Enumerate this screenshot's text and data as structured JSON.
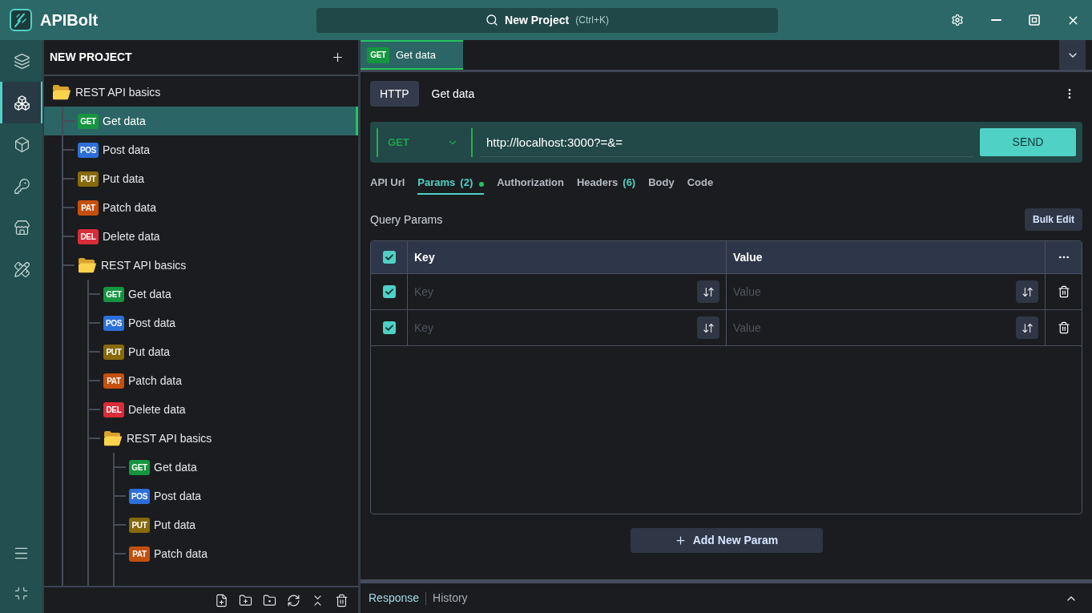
{
  "app": {
    "name": "APIBolt"
  },
  "search": {
    "label": "New Project",
    "shortcut": "(Ctrl+K)"
  },
  "activity_bar": [
    {
      "selected": false
    },
    {
      "selected": true
    },
    {
      "selected": false
    },
    {
      "selected": false
    },
    {
      "selected": false
    },
    {
      "selected": false
    }
  ],
  "sidebar": {
    "title": "NEW PROJECT",
    "tree": [
      {
        "kind": "folder",
        "label": "REST API basics",
        "expanded": true,
        "selected": false,
        "children": [
          {
            "kind": "request",
            "method": "GET",
            "color": "#15953f",
            "label": "Get data",
            "selected": true
          },
          {
            "kind": "request",
            "method": "POS",
            "color": "#2d6fd8",
            "label": "Post data",
            "selected": false
          },
          {
            "kind": "request",
            "method": "PUT",
            "color": "#876a0c",
            "label": "Put data",
            "selected": false
          },
          {
            "kind": "request",
            "method": "PAT",
            "color": "#c4500e",
            "label": "Patch data",
            "selected": false
          },
          {
            "kind": "request",
            "method": "DEL",
            "color": "#d92b38",
            "label": "Delete data",
            "selected": false
          },
          {
            "kind": "folder",
            "label": "REST API basics",
            "expanded": true,
            "selected": false,
            "children": [
              {
                "kind": "request",
                "method": "GET",
                "color": "#15953f",
                "label": "Get data",
                "selected": false
              },
              {
                "kind": "request",
                "method": "POS",
                "color": "#2d6fd8",
                "label": "Post data",
                "selected": false
              },
              {
                "kind": "request",
                "method": "PUT",
                "color": "#876a0c",
                "label": "Put data",
                "selected": false
              },
              {
                "kind": "request",
                "method": "PAT",
                "color": "#c4500e",
                "label": "Patch data",
                "selected": false
              },
              {
                "kind": "request",
                "method": "DEL",
                "color": "#d92b38",
                "label": "Delete data",
                "selected": false
              },
              {
                "kind": "folder",
                "label": "REST API basics",
                "expanded": true,
                "selected": false,
                "children": [
                  {
                    "kind": "request",
                    "method": "GET",
                    "color": "#15953f",
                    "label": "Get data",
                    "selected": false
                  },
                  {
                    "kind": "request",
                    "method": "POS",
                    "color": "#2d6fd8",
                    "label": "Post data",
                    "selected": false
                  },
                  {
                    "kind": "request",
                    "method": "PUT",
                    "color": "#876a0c",
                    "label": "Put data",
                    "selected": false
                  },
                  {
                    "kind": "request",
                    "method": "PAT",
                    "color": "#c4500e",
                    "label": "Patch data",
                    "selected": false
                  }
                ]
              }
            ]
          }
        ]
      }
    ]
  },
  "editor_tabs": [
    {
      "method": "GET",
      "color": "#15953f",
      "label": "Get data",
      "selected": true
    }
  ],
  "request": {
    "type": "HTTP",
    "name": "Get data",
    "method": "GET",
    "url": "http://localhost:3000?=&=",
    "send": "SEND"
  },
  "request_tabs": [
    {
      "label": "API Url",
      "selected": false
    },
    {
      "label": "Params",
      "count": "(2)",
      "indicator": true,
      "selected": true
    },
    {
      "label": "Authorization",
      "selected": false
    },
    {
      "label": "Headers",
      "count": "(6)",
      "selected": false
    },
    {
      "label": "Body",
      "selected": false
    },
    {
      "label": "Code",
      "selected": false
    }
  ],
  "query_params": {
    "title": "Query Params",
    "bulk_edit": "Bulk Edit",
    "all_checked": true,
    "columns": [
      "Key",
      "Value"
    ],
    "rows": [
      {
        "checked": true,
        "key_placeholder": "Key",
        "value_placeholder": "Value"
      },
      {
        "checked": true,
        "key_placeholder": "Key",
        "value_placeholder": "Value"
      }
    ],
    "add_button": "Add New Param"
  },
  "bottom_panel": {
    "tabs": [
      {
        "label": "Response",
        "selected": true
      },
      {
        "label": "History",
        "selected": false
      }
    ]
  }
}
